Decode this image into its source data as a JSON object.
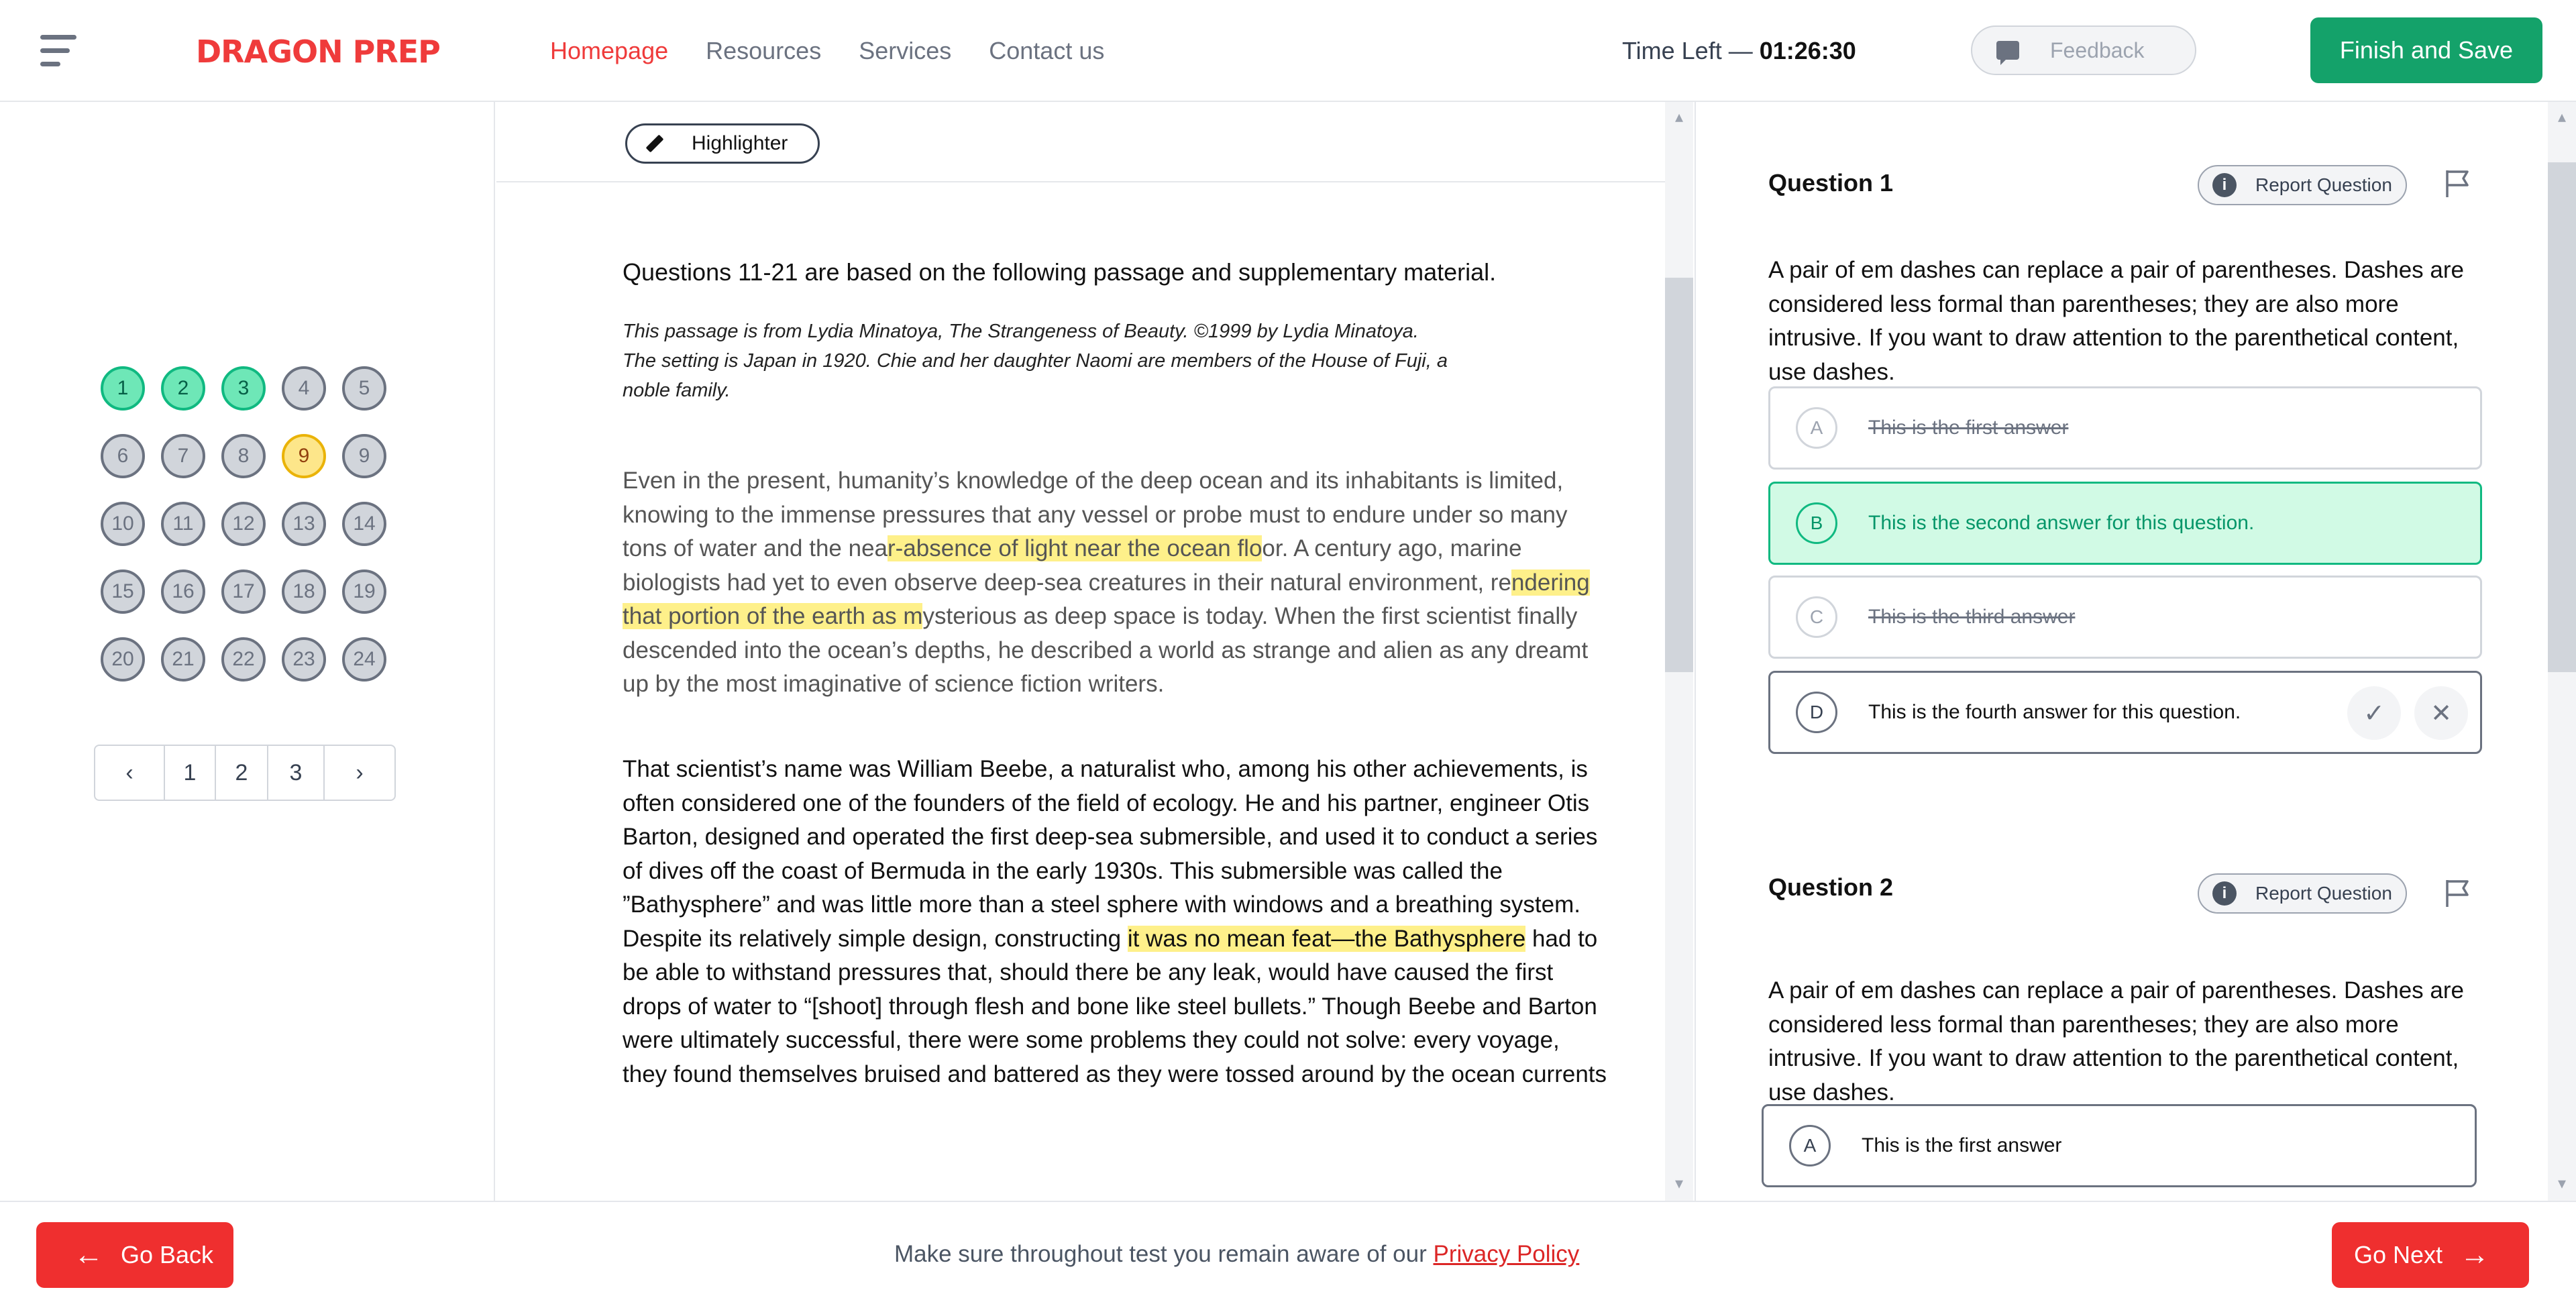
{
  "header": {
    "logo": "DRAGON PREP",
    "nav": [
      "Homepage",
      "Resources",
      "Services",
      "Contact us"
    ],
    "timer_label": "Time Left — ",
    "timer_value": "01:26:30",
    "feedback_label": "Feedback",
    "finish_label": "Finish and Save"
  },
  "navigator": {
    "numbers": [
      "1",
      "2",
      "3",
      "4",
      "5",
      "6",
      "7",
      "8",
      "9",
      "9",
      "10",
      "11",
      "12",
      "13",
      "14",
      "15",
      "16",
      "17",
      "18",
      "19",
      "20",
      "21",
      "22",
      "23",
      "24"
    ],
    "states": [
      "done",
      "done",
      "done",
      "",
      "",
      "",
      "",
      "",
      "current",
      "",
      "",
      "",
      "",
      "",
      "",
      "",
      "",
      "",
      "",
      "",
      "",
      "",
      "",
      "",
      ""
    ],
    "pages": [
      "1",
      "2",
      "3"
    ],
    "prev_icon": "chevron-left-icon",
    "next_icon": "chevron-right-icon"
  },
  "passage": {
    "highlighter_label": "Highlighter",
    "intro": "Questions 11-21 are based on the following passage and supplementary material.",
    "source": "This passage is from Lydia Minatoya, The Strangeness of Beauty. ©1999 by Lydia Minatoya. The setting is Japan in 1920. Chie and her daughter Naomi are members of the House of Fuji, a noble family.",
    "p1": [
      {
        "t": "Even in the present, humanity’s knowledge of the deep ocean and its inhabitants is limited, knowing to the immense pressures that any vessel or probe must to endure under so many tons of water and the nea",
        "h": false
      },
      {
        "t": "r-absence of light near the ocean flo",
        "h": true
      },
      {
        "t": "or. A century ago, marine biologists had yet to even observe deep-sea creatures in their natural environment, re",
        "h": false
      },
      {
        "t": "ndering that portion of the earth as m",
        "h": true
      },
      {
        "t": "ysterious as deep space is today. When the first scientist finally descended into the ocean’s depths, he described a world as strange and alien as any dreamt up by the most imaginative of science fiction writers.",
        "h": false
      }
    ],
    "p2": [
      {
        "t": "That scientist’s name was William Beebe, a naturalist who, among his other achievements, is often considered one of the founders of the field of ecology. He and his partner, engineer Otis Barton, designed and operated the first deep-sea submersible, and used it to conduct a series of dives off the coast of Bermuda in the early 1930s. This submersible was called the ”Bathysphere” and was little more than a steel sphere with windows and a breathing system. Despite its relatively simple design, constructing ",
        "h": false
      },
      {
        "t": "it was no mean feat—the Bathysphere",
        "h": true
      },
      {
        "t": " had to be able to withstand pressures that, should there be any leak, would have caused the first drops of water to “[shoot] through flesh and bone like steel bullets.” Though Beebe and Barton were ultimately successful, there were some problems they could not solve: every voyage, they found themselves bruised and battered as they were tossed around by the ocean currents",
        "h": false
      }
    ]
  },
  "questions": {
    "report_label": "Report Question",
    "q1": {
      "title": "Question 1",
      "text": "A pair of em dashes can replace a pair of parentheses. Dashes are considered less formal than parentheses; they are also more intrusive. If you want to draw attention to the parenthetical content, use dashes.",
      "answers": [
        {
          "letter": "A",
          "text": "This is the first answer"
        },
        {
          "letter": "B",
          "text": "This is the second answer for this question."
        },
        {
          "letter": "C",
          "text": "This is the third answer"
        },
        {
          "letter": "D",
          "text": "This is the fourth answer for this question."
        }
      ]
    },
    "q2": {
      "title": "Question 2",
      "text": "A pair of em dashes can replace a pair of parentheses. Dashes are considered less formal than parentheses; they are also more intrusive. If you want to draw attention to the parenthetical content, use dashes.",
      "answers": [
        {
          "letter": "A",
          "text": "This is the first answer"
        }
      ]
    }
  },
  "footer": {
    "back_label": "Go Back",
    "next_label": "Go Next",
    "notice": "Make sure throughout test you remain aware of our ",
    "policy_link": "Privacy Policy"
  },
  "colors": {
    "brand_red": "#ef3b3b",
    "accent_green": "#14a26a",
    "highlight": "#fef08a"
  }
}
